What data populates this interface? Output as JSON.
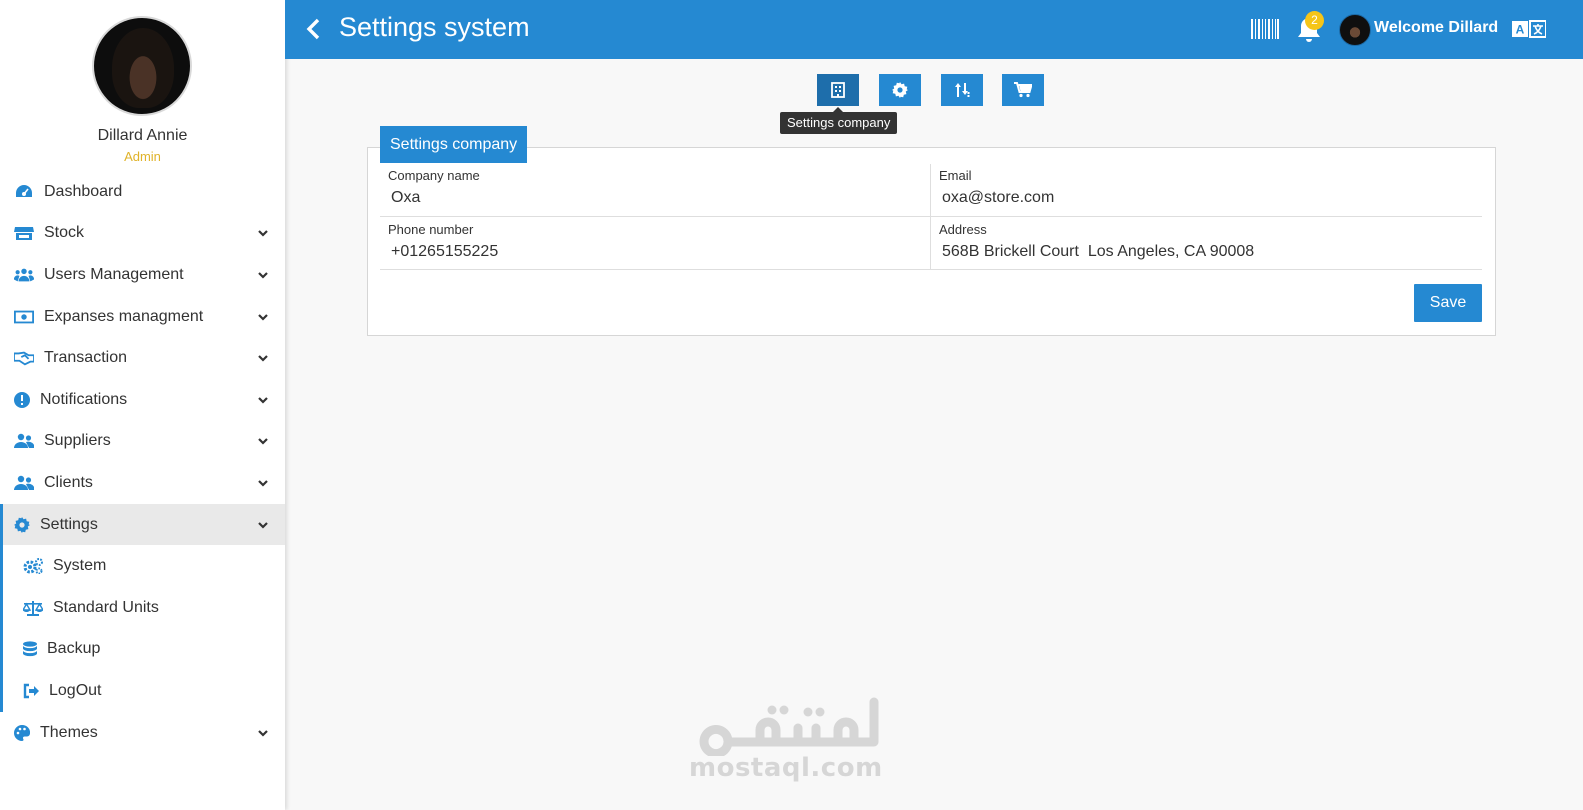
{
  "header": {
    "title": "Settings system",
    "notification_count": "2",
    "welcome_text": "Welcome Dillard"
  },
  "user": {
    "name": "Dillard Annie",
    "role": "Admin"
  },
  "sidebar": {
    "items": [
      {
        "label": "Dashboard",
        "icon": "dashboard-icon"
      },
      {
        "label": "Stock",
        "icon": "store-icon"
      },
      {
        "label": "Users Management",
        "icon": "users-icon"
      },
      {
        "label": "Expanses managment",
        "icon": "money-icon"
      },
      {
        "label": "Transaction",
        "icon": "handshake-icon"
      },
      {
        "label": "Notifications",
        "icon": "alert-icon"
      },
      {
        "label": "Suppliers",
        "icon": "users-icon"
      },
      {
        "label": "Clients",
        "icon": "users-icon"
      },
      {
        "label": "Settings",
        "icon": "gear-icon"
      },
      {
        "label": "Themes",
        "icon": "palette-icon"
      }
    ],
    "settings_subitems": [
      {
        "label": "System",
        "icon": "gears-icon"
      },
      {
        "label": "Standard Units",
        "icon": "scale-icon"
      },
      {
        "label": "Backup",
        "icon": "database-icon"
      },
      {
        "label": "LogOut",
        "icon": "logout-icon"
      }
    ]
  },
  "tabs": {
    "active_tooltip": "Settings company",
    "icons": [
      "building-icon",
      "gear-icon",
      "sort-icon",
      "cart-icon"
    ]
  },
  "company_form": {
    "title": "Settings company",
    "company_name_label": "Company name",
    "company_name_value": "Oxa",
    "email_label": "Email",
    "email_value": "oxa@store.com",
    "phone_label": "Phone number",
    "phone_value": "+01265155225",
    "address_label": "Address",
    "address_value": "568B Brickell Court  Los Angeles, CA 90008",
    "save_label": "Save"
  },
  "watermark": {
    "latin": "mostaql.com",
    "arabic": "مستقل"
  },
  "colors": {
    "primary": "#2589d2",
    "primary_dark": "#1e6eab",
    "badge": "#f5c518",
    "role": "#e0b32a"
  }
}
